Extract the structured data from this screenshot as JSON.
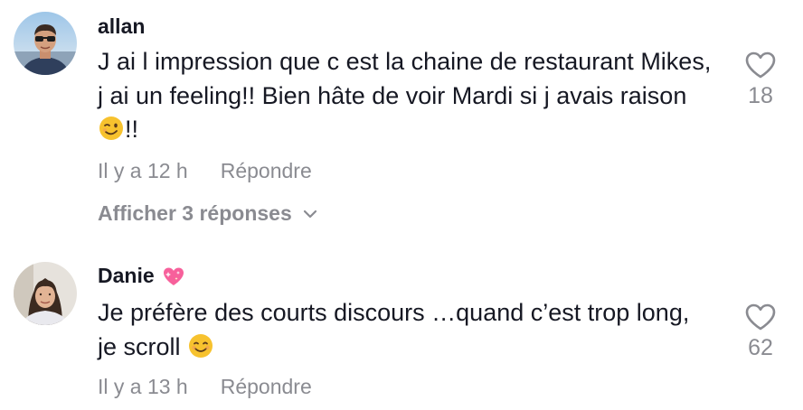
{
  "comments": [
    {
      "username": "allan",
      "text_before_emoji": "J ai l impression que c est la chaine de restaurant Mikes, j ai un feeling!! Bien hâte de voir Mardi si j avais raison ",
      "emoji": "winking-face-emoji",
      "text_after_emoji": "!!",
      "time": "Il y a 12 h",
      "reply_label": "Répondre",
      "view_replies_label": "Afficher 3 réponses",
      "likes": "18"
    },
    {
      "username": "Danie",
      "username_emoji": "sparkling-heart-emoji",
      "text_before_emoji": "Je préfère des courts discours …quand c’est trop long, je scroll ",
      "emoji": "smiling-face-emoji",
      "text_after_emoji": "",
      "time": "Il y a 13 h",
      "reply_label": "Répondre",
      "likes": "62"
    }
  ],
  "colors": {
    "text": "#161823",
    "secondary": "#8a8b91",
    "heart_outline": "#8a8b91",
    "emoji_yellow": "#f7c22e",
    "heart_pink": "#f7609b"
  }
}
